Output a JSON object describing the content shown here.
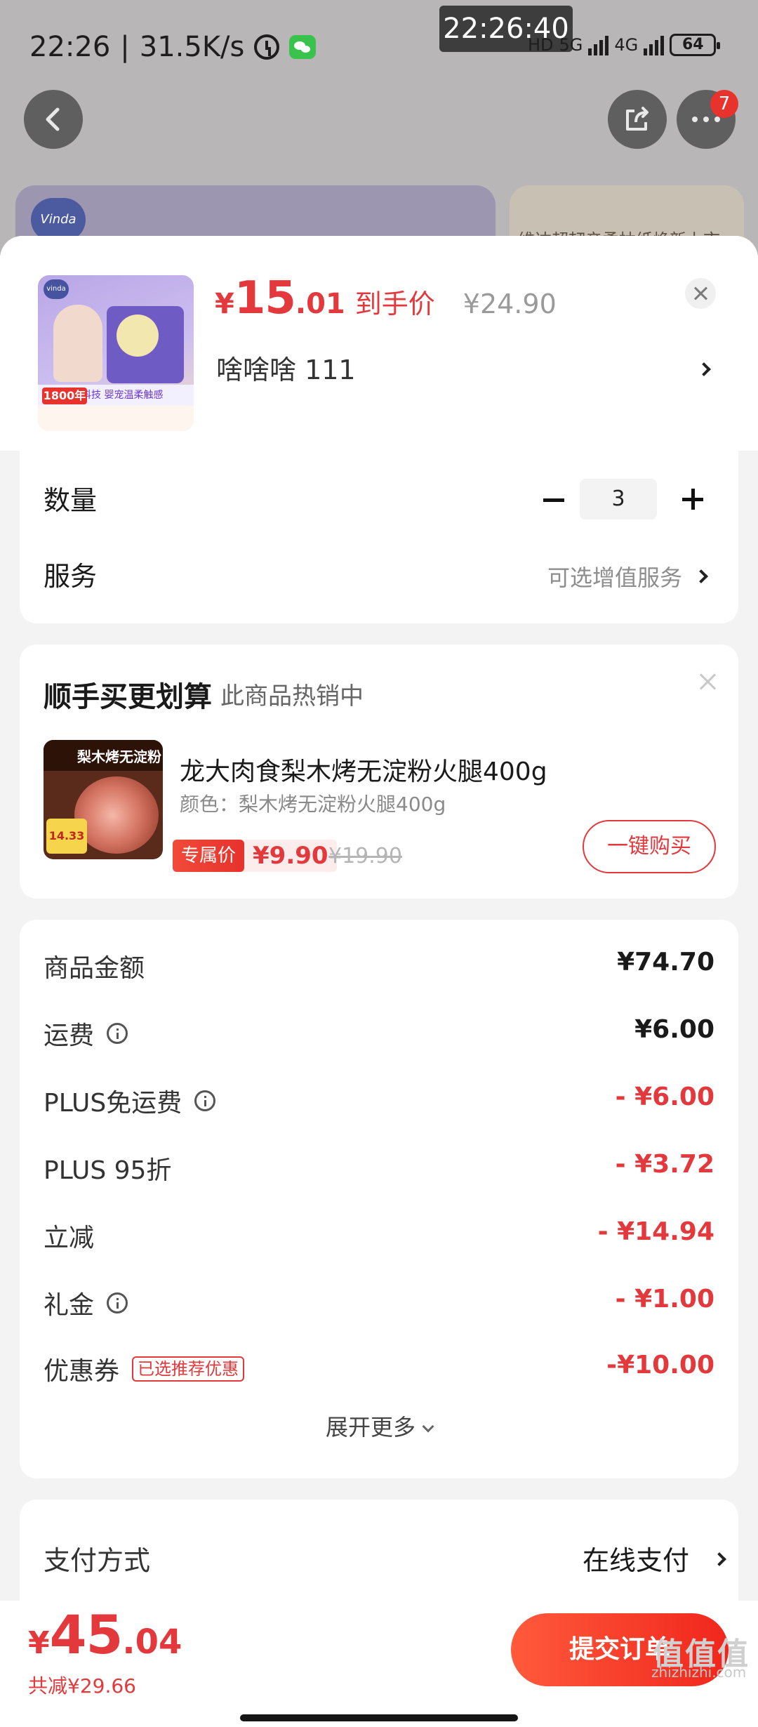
{
  "status_bar": {
    "time": "22:26",
    "speed": "31.5K/s",
    "time_overlay": "22:26:40",
    "hd_label": "HD",
    "net1": "5G",
    "net2": "4G",
    "battery": "64"
  },
  "nav": {
    "badge_count": "7"
  },
  "background": {
    "card2_text": "维达超韧亲柔抽纸焕新上市",
    "logo_text": "Vinda"
  },
  "product": {
    "price_yen": "¥",
    "price_int": "15",
    "price_dec": ".01",
    "price_tag": "到手价",
    "orig_price": "¥24.90",
    "spec": "啥啥啥   111",
    "thumb_badge": "1800年",
    "thumb_text": "空气感黑科技 婴宠温柔触感"
  },
  "quantity": {
    "label": "数量",
    "value": "3"
  },
  "service": {
    "label": "服务",
    "hint": "可选增值服务"
  },
  "upsell": {
    "title": "顺手买更划算",
    "subtitle": "此商品热销中",
    "name": "龙大肉食梨木烤无淀粉火腿400g",
    "color": "颜色：梨木烤无淀粉火腿400g",
    "price_tag": "专属价",
    "price": "¥9.90",
    "orig_price": "¥19.90",
    "buy_label": "一键购买",
    "thumb_title": "梨木烤无淀粉!",
    "thumb_price": "14.33"
  },
  "summary": {
    "rows": [
      {
        "label": "商品金额",
        "value": "¥74.70"
      },
      {
        "label": "运费",
        "value": "¥6.00"
      },
      {
        "label": "PLUS免运费",
        "value": "- ¥6.00"
      },
      {
        "label": "PLUS 95折",
        "value": "- ¥3.72"
      },
      {
        "label": "立减",
        "value": "- ¥14.94"
      },
      {
        "label": "礼金",
        "value": "- ¥1.00"
      },
      {
        "label": "优惠券",
        "value": "-¥10.00",
        "tag": "已选推荐优惠"
      }
    ],
    "expand_label": "展开更多"
  },
  "payment": {
    "label": "支付方式",
    "value": "在线支付"
  },
  "footer": {
    "yen": "¥",
    "total_int": "45",
    "total_dec": ".04",
    "saved": "共减¥29.66",
    "submit": "提交订单",
    "watermark": "zhizhizhi.com",
    "watermark_mark": "值值值"
  },
  "colors": {
    "accent": "#e4393c",
    "sheet_bg": "#f3f3f3"
  }
}
